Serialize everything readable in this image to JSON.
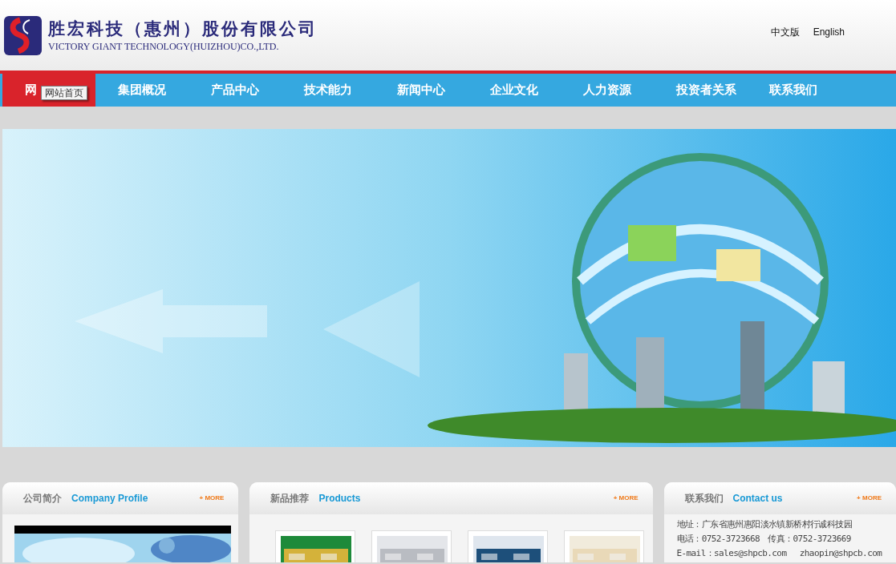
{
  "header": {
    "company_name": "胜宏科技（惠州）股份有限公司",
    "company_name_en": "VICTORY GIANT TECHNOLOGY(HUIZHOU)CO.,LTD.",
    "languages": [
      {
        "label": "中文版"
      },
      {
        "label": "English"
      }
    ]
  },
  "nav": {
    "items": [
      {
        "label": "网",
        "selected": true
      },
      {
        "label": "集团概况",
        "selected": false
      },
      {
        "label": "产品中心",
        "selected": false
      },
      {
        "label": "技术能力",
        "selected": false
      },
      {
        "label": "新闻中心",
        "selected": false
      },
      {
        "label": "企业文化",
        "selected": false
      },
      {
        "label": "人力资源",
        "selected": false
      },
      {
        "label": "投资者关系",
        "selected": false
      },
      {
        "label": "联系我们",
        "selected": false
      }
    ],
    "tooltip": "网站首页"
  },
  "panels": [
    {
      "kind": "profile",
      "title": "公司简介",
      "title_en": "Company Profile",
      "more": "+ MORE"
    },
    {
      "kind": "products",
      "title": "新品推荐",
      "title_en": "Products",
      "more": "+ MORE"
    },
    {
      "kind": "contact",
      "title": "联系我们",
      "title_en": "Contact us",
      "more": "+ MORE",
      "lines": [
        "地址：广东省惠州惠阳淡水镇新桥村行诚科技园",
        "电话：0752-3723668　传真：0752-3723669",
        "E-mail：sales@shpcb.com　 zhaopin@shpcb.com"
      ]
    }
  ]
}
